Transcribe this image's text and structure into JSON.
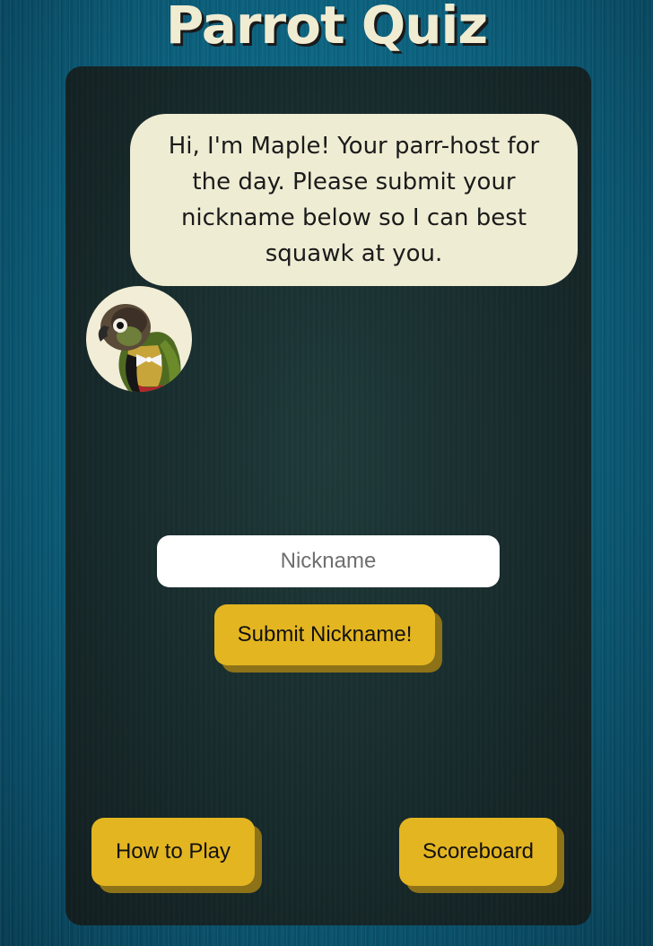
{
  "page": {
    "title": "Parrot Quiz"
  },
  "host": {
    "message": "Hi, I'm Maple! Your parr-host for the day. Please submit your nickname below so I can best squawk at you.",
    "avatar_icon": "parrot-avatar"
  },
  "form": {
    "nickname_placeholder": "Nickname",
    "nickname_value": "",
    "submit_label": "Submit Nickname!"
  },
  "footer": {
    "how_to_play_label": "How to Play",
    "scoreboard_label": "Scoreboard"
  },
  "colors": {
    "background": "#0a5f7c",
    "panel": "#172a2b",
    "bubble": "#efecd4",
    "button": "#e3b521",
    "button_shadow": "#8d7218",
    "title_text": "#f0ecd2"
  }
}
